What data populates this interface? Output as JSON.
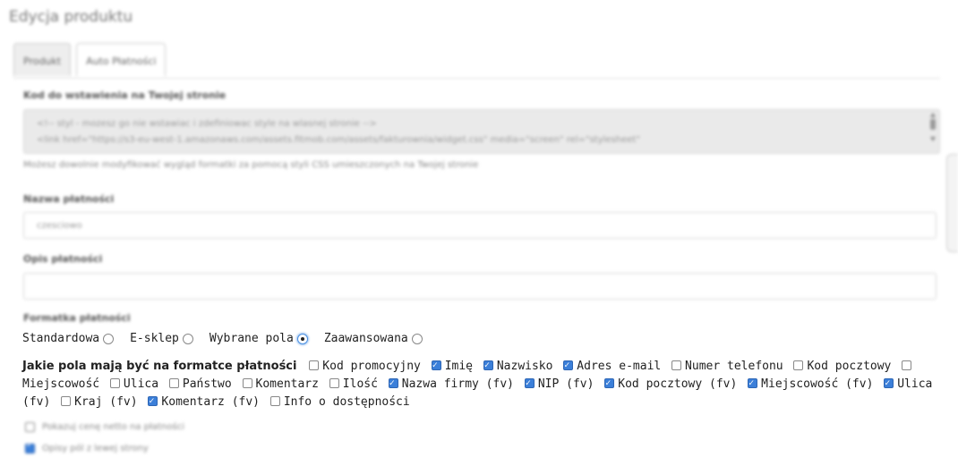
{
  "header": {
    "title": "Edycja produktu"
  },
  "tabs": [
    {
      "label": "Produkt",
      "active": true
    },
    {
      "label": "Auto Płatności",
      "active": false
    }
  ],
  "embed": {
    "label": "Kod do wstawienia na Twojej stronie",
    "code_lines": [
      "<!-- styl - mozesz go nie wstawiac i zdefiniowac style na wlasnej stronie -->",
      "<link href=\"https://s3-eu-west-1.amazonaws.com/assets.fitmob.com/assets/fakturownia/widget.css\" media=\"screen\" rel=\"stylesheet\""
    ],
    "hint": "Możesz dowolnie modyfikować wygląd formatki za pomocą styli CSS umieszczonych na Twojej stronie"
  },
  "payment_name": {
    "label": "Nazwa płatności",
    "value": "czesciowo"
  },
  "payment_desc": {
    "label": "Opis płatności",
    "value": ""
  },
  "form_type": {
    "label": "Formatka płatności",
    "options": [
      {
        "label": "Standardowa",
        "selected": false
      },
      {
        "label": "E-sklep",
        "selected": false
      },
      {
        "label": "Wybrane pola",
        "selected": true
      },
      {
        "label": "Zaawansowana",
        "selected": false
      }
    ]
  },
  "fields": {
    "title": "Jakie pola mają być na formatce płatności",
    "items": [
      {
        "label": "Kod promocyjny",
        "checked": false
      },
      {
        "label": "Imię",
        "checked": true
      },
      {
        "label": "Nazwisko",
        "checked": true
      },
      {
        "label": "Adres e-mail",
        "checked": true
      },
      {
        "label": "Numer telefonu",
        "checked": false
      },
      {
        "label": "Kod pocztowy",
        "checked": false
      },
      {
        "label": "Miejscowość",
        "checked": false
      },
      {
        "label": "Ulica",
        "checked": false
      },
      {
        "label": "Państwo",
        "checked": false
      },
      {
        "label": "Komentarz",
        "checked": false
      },
      {
        "label": "Ilość",
        "checked": true
      },
      {
        "label": "Nazwa firmy (fv)",
        "checked": true
      },
      {
        "label": "NIP (fv)",
        "checked": true
      },
      {
        "label": "Kod pocztowy (fv)",
        "checked": true
      },
      {
        "label": "Miejscowość (fv)",
        "checked": true
      },
      {
        "label": "Ulica (fv)",
        "checked": false
      },
      {
        "label": "Kraj (fv)",
        "checked": true
      },
      {
        "label": "Komentarz (fv)",
        "checked": false
      },
      {
        "label": "Info o dostępności",
        "checked": null
      }
    ]
  },
  "extra": [
    {
      "label": "Pokazuj cenę netto na płatności",
      "checked": false
    },
    {
      "label": "Opisy pól z lewej strony",
      "checked": true
    }
  ],
  "colors": {
    "accent": "#3b7fd9",
    "muted": "#888888"
  }
}
